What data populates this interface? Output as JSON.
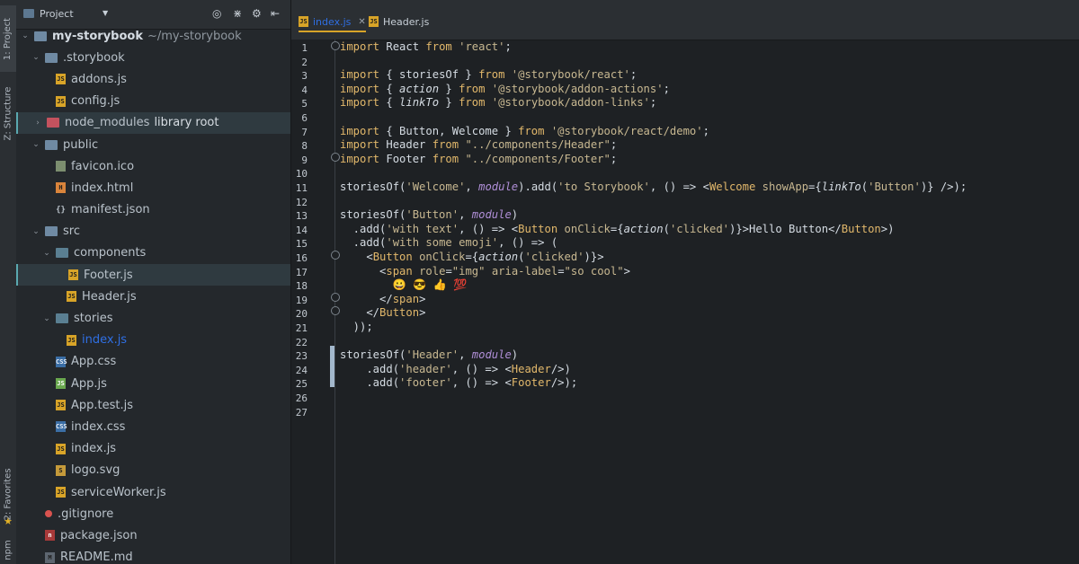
{
  "sidebar_tabs": {
    "project": "1: Project",
    "structure": "Z: Structure",
    "favorites": "2: Favorites",
    "npm": "npm"
  },
  "project_panel": {
    "title": "Project",
    "tree": [
      {
        "name": "my-storybook",
        "extra": "~/my-storybook",
        "type": "root-folder",
        "depth": 0,
        "expanded": true
      },
      {
        "name": ".storybook",
        "type": "folder",
        "depth": 1,
        "expanded": true
      },
      {
        "name": "addons.js",
        "type": "js",
        "depth": 2
      },
      {
        "name": "config.js",
        "type": "js",
        "depth": 2
      },
      {
        "name": "node_modules",
        "extra": "library root",
        "type": "folder-red",
        "depth": 1,
        "expanded": false,
        "selected": true
      },
      {
        "name": "public",
        "type": "folder",
        "depth": 1,
        "expanded": true
      },
      {
        "name": "favicon.ico",
        "type": "ico",
        "depth": 2
      },
      {
        "name": "index.html",
        "type": "html",
        "depth": 2
      },
      {
        "name": "manifest.json",
        "type": "json",
        "depth": 2
      },
      {
        "name": "src",
        "type": "folder",
        "depth": 1,
        "expanded": true
      },
      {
        "name": "components",
        "type": "folder-teal",
        "depth": 2,
        "expanded": true
      },
      {
        "name": "Footer.js",
        "type": "js",
        "depth": 3,
        "highlight": true
      },
      {
        "name": "Header.js",
        "type": "js",
        "depth": 3
      },
      {
        "name": "stories",
        "type": "folder-teal",
        "depth": 2,
        "expanded": true
      },
      {
        "name": "index.js",
        "type": "js",
        "depth": 3,
        "active": true
      },
      {
        "name": "App.css",
        "type": "css",
        "depth": 2
      },
      {
        "name": "App.js",
        "type": "app",
        "depth": 2
      },
      {
        "name": "App.test.js",
        "type": "js",
        "depth": 2
      },
      {
        "name": "index.css",
        "type": "css",
        "depth": 2
      },
      {
        "name": "index.js",
        "type": "js",
        "depth": 2
      },
      {
        "name": "logo.svg",
        "type": "svg",
        "depth": 2
      },
      {
        "name": "serviceWorker.js",
        "type": "js",
        "depth": 2
      },
      {
        "name": ".gitignore",
        "type": "git",
        "depth": 1
      },
      {
        "name": "package.json",
        "type": "npm",
        "depth": 1
      },
      {
        "name": "README.md",
        "type": "md",
        "depth": 1
      }
    ]
  },
  "editor_tabs": [
    {
      "label": "index.js",
      "active": true
    },
    {
      "label": "Header.js",
      "active": false
    }
  ],
  "code_lines": [
    "import React from 'react';",
    "",
    "import { storiesOf } from '@storybook/react';",
    "import { action } from '@storybook/addon-actions';",
    "import { linkTo } from '@storybook/addon-links';",
    "",
    "import { Button, Welcome } from '@storybook/react/demo';",
    "import Header from \"../components/Header\";",
    "import Footer from \"../components/Footer\";",
    "",
    "storiesOf('Welcome', module).add('to Storybook', () => <Welcome showApp={linkTo('Button')} />);",
    "",
    "storiesOf('Button', module)",
    "  .add('with text', () => <Button onClick={action('clicked')}>Hello Button</Button>)",
    "  .add('with some emoji', () => (",
    "    <Button onClick={action('clicked')}>",
    "      <span role=\"img\" aria-label=\"so cool\">",
    "        😀 😎 👍 💯",
    "      </span>",
    "    </Button>",
    "  ));",
    "",
    "storiesOf('Header', module)",
    "    .add('header', () => <Header/>)",
    "    .add('footer', () => <Footer/>);",
    "",
    ""
  ]
}
